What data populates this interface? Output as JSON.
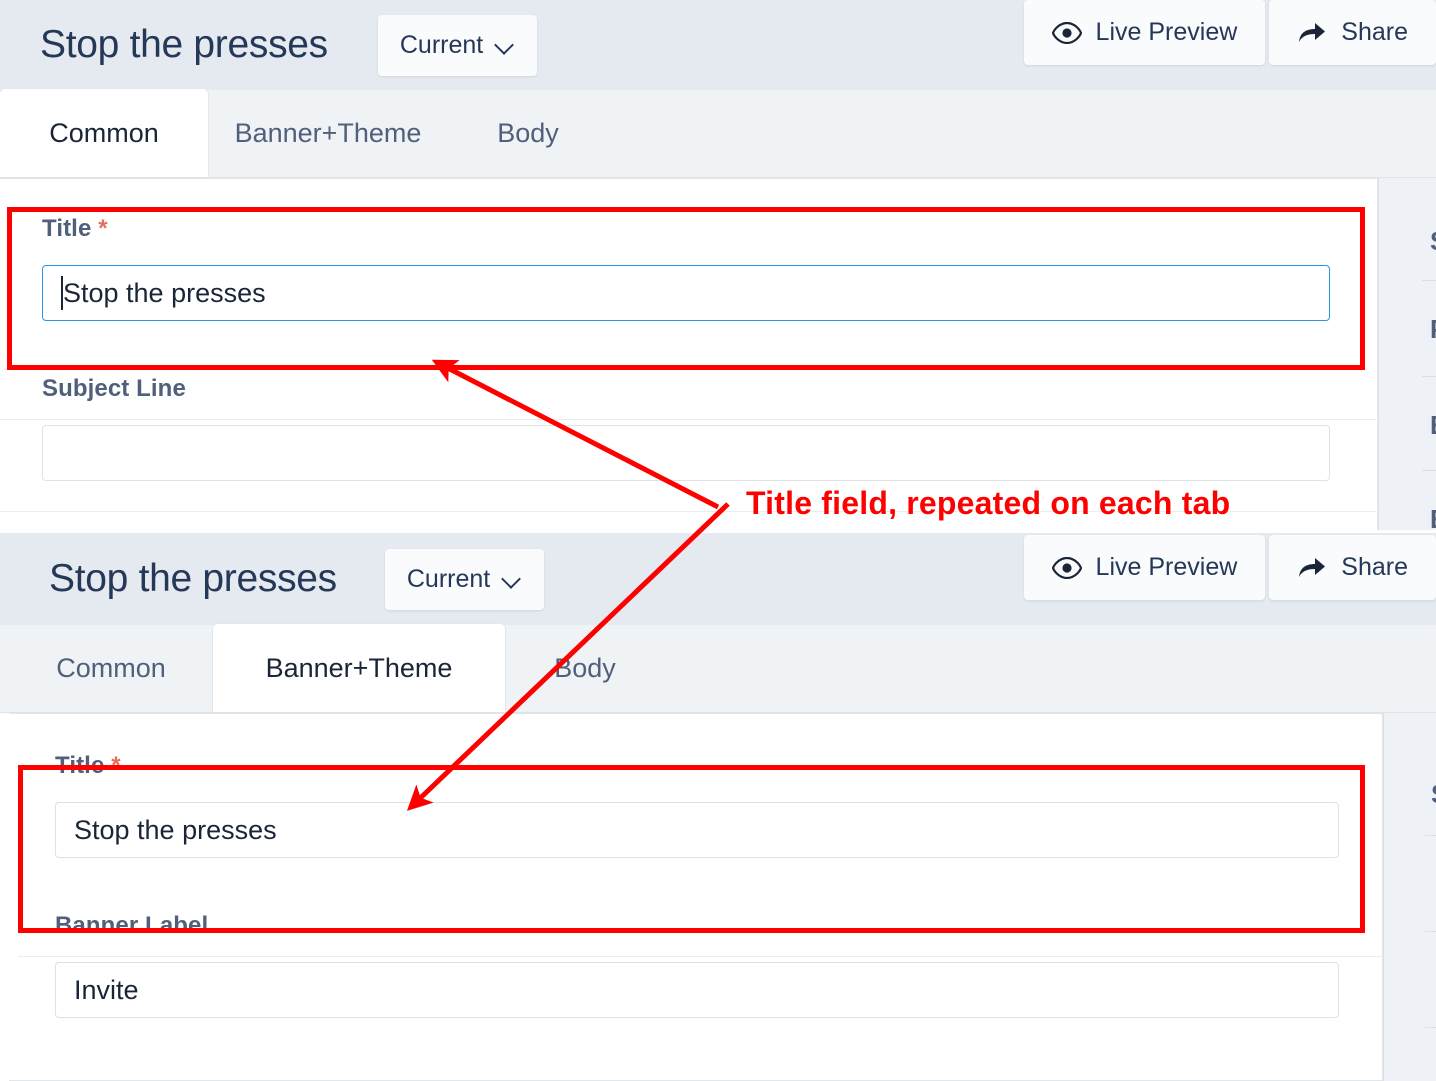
{
  "panels": [
    {
      "id": "panel-common",
      "header": {
        "title": "Stop the presses",
        "version_button": {
          "label": "Current",
          "icon": "chevron-down-icon"
        },
        "actions": [
          {
            "label": "Live Preview",
            "icon": "eye-icon"
          },
          {
            "label": "Share",
            "icon": "share-arrow-icon"
          }
        ]
      },
      "tabs": [
        {
          "label": "Common",
          "active": true
        },
        {
          "label": "Banner+Theme",
          "active": false
        },
        {
          "label": "Body",
          "active": false
        }
      ],
      "fields": [
        {
          "label": "Title",
          "required": true,
          "required_mark": "*",
          "value": "Stop the presses",
          "focused": true
        },
        {
          "label": "Subject Line",
          "required": false,
          "required_mark": "",
          "value": "",
          "focused": false
        }
      ],
      "right_rail": [
        "S",
        "P",
        "E",
        "E"
      ]
    },
    {
      "id": "panel-banner-theme",
      "header": {
        "title": "Stop the presses",
        "version_button": {
          "label": "Current",
          "icon": "chevron-down-icon"
        },
        "actions": [
          {
            "label": "Live Preview",
            "icon": "eye-icon"
          },
          {
            "label": "Share",
            "icon": "share-arrow-icon"
          }
        ]
      },
      "tabs": [
        {
          "label": "Common",
          "active": false
        },
        {
          "label": "Banner+Theme",
          "active": true
        },
        {
          "label": "Body",
          "active": false
        }
      ],
      "fields": [
        {
          "label": "Title",
          "required": true,
          "required_mark": "*",
          "value": "Stop the presses",
          "focused": false
        },
        {
          "label": "Banner Label",
          "required": false,
          "required_mark": "",
          "value": "Invite",
          "focused": false
        }
      ],
      "right_rail": [
        "S",
        "",
        "",
        ""
      ]
    }
  ],
  "annotation": {
    "text": "Title field, repeated on each tab",
    "color": "#fe0000"
  },
  "colors": {
    "header_bg": "#e5eaf0",
    "tabbar_bg": "#f0f3f6",
    "active_tab_bg": "#ffffff",
    "label_text": "#51607a",
    "title_text": "#253858",
    "focus_border": "#2a96e8",
    "required_star": "#e2705a",
    "annotation": "#fe0000",
    "rail_bg": "#eef1f5",
    "dark_gutter": "#26303f"
  }
}
